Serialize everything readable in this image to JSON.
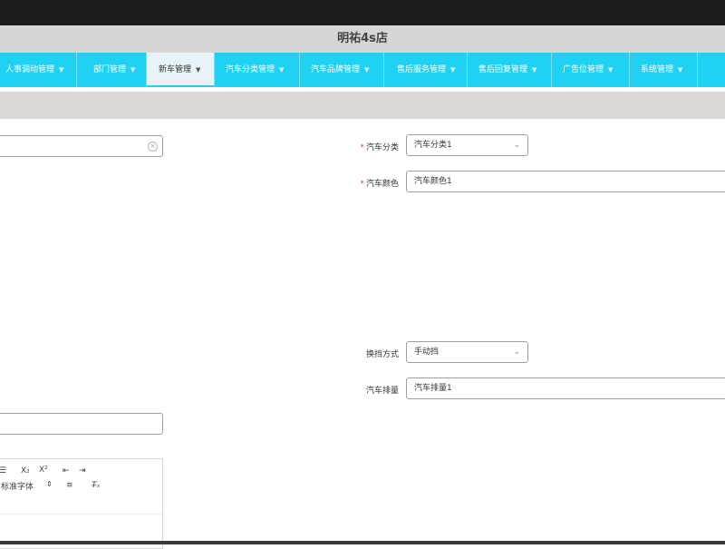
{
  "app": {
    "title": "明祐4s店"
  },
  "nav": {
    "items": [
      {
        "label": "人事调动管理"
      },
      {
        "label": "部门管理"
      },
      {
        "label": "新车管理"
      },
      {
        "label": "汽车分类管理"
      },
      {
        "label": "汽车品牌管理"
      },
      {
        "label": "售后服务管理"
      },
      {
        "label": "售后回复管理"
      },
      {
        "label": "广告位管理"
      },
      {
        "label": "系统管理"
      }
    ],
    "active": "新车管理"
  },
  "form": {
    "car_category": {
      "required_mark": "*",
      "label": "汽车分类",
      "value": "汽车分类1"
    },
    "car_color": {
      "required_mark": "*",
      "label": "汽车颜色",
      "value": "汽车颜色1"
    },
    "transmission": {
      "label": "换挡方式",
      "value": "手动挡"
    },
    "displacement": {
      "label": "汽车排量",
      "value": "汽车排量1"
    }
  },
  "editor": {
    "toolbar": {
      "subscript": "X₂",
      "superscript": "X²",
      "font_select": "标准字体",
      "select_arrow": "⇕",
      "clear_format": "T̶ₓ"
    }
  },
  "colors": {
    "nav_bg": "#1fd2f4",
    "title_bg": "#d8d6d4",
    "top_bar": "#1c1c1c",
    "required": "#e64242"
  },
  "icons": {
    "clear": "clear-circle-icon",
    "dropdown": "chevron-down-icon"
  }
}
